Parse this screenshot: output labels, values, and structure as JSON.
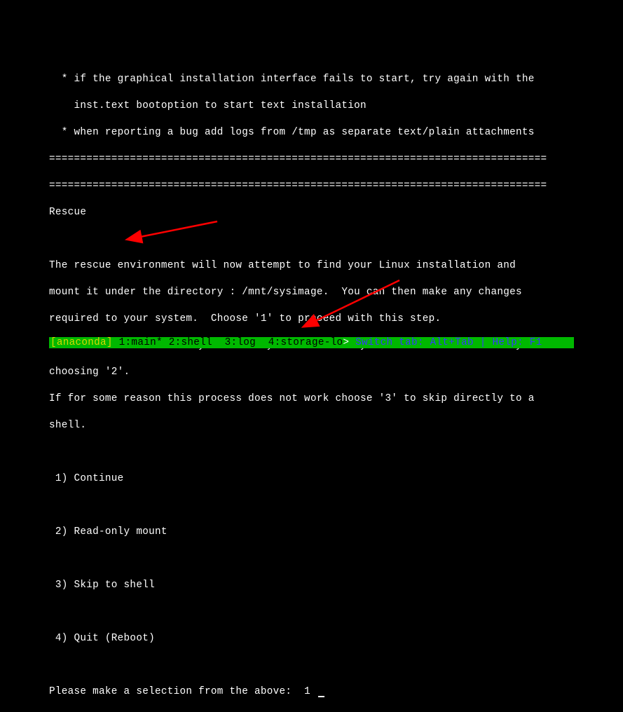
{
  "tips": {
    "line1": "  * if the graphical installation interface fails to start, try again with the",
    "line2": "    inst.text bootoption to start text installation",
    "line3": "  * when reporting a bug add logs from /tmp as separate text/plain attachments"
  },
  "separator": "================================================================================",
  "title": "Rescue",
  "description": {
    "line1": "The rescue environment will now attempt to find your Linux installation and",
    "line2": "mount it under the directory : /mnt/sysimage.  You can then make any changes",
    "line3": "required to your system.  Choose '1' to proceed with this step.",
    "line4": "You can choose to mount your file systems read-only instead of read-write by",
    "line5": "choosing '2'.",
    "line6": "If for some reason this process does not work choose '3' to skip directly to a",
    "line7": "shell."
  },
  "options": {
    "opt1": " 1) Continue",
    "opt2": " 2) Read-only mount",
    "opt3": " 3) Skip to shell",
    "opt4": " 4) Quit (Reboot)"
  },
  "prompt": {
    "text": "Please make a selection from the above:  ",
    "value": "1"
  },
  "statusbar": {
    "left": "[anaconda]",
    "tabs": " 1:main* 2:shell  3:log  4:storage-lo",
    "arrow": ">",
    "help": " Switch tab: Alt+Tab | Help: F1"
  }
}
